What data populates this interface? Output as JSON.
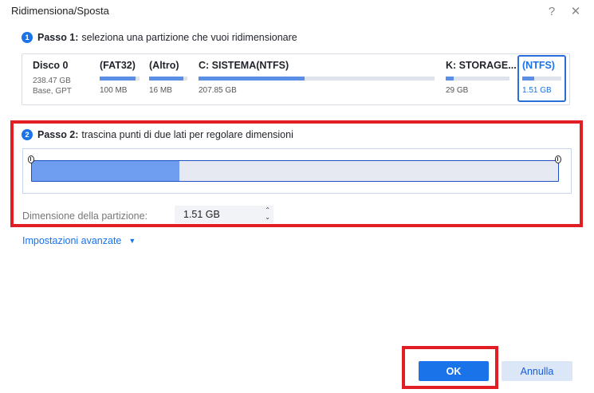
{
  "window": {
    "title": "Ridimensiona/Sposta",
    "help_glyph": "?",
    "close_glyph": "✕"
  },
  "step1": {
    "number": "1",
    "label": "Passo 1:",
    "text": "seleziona una partizione che vuoi ridimensionare"
  },
  "disk": {
    "name": "Disco 0",
    "capacity": "238.47 GB",
    "type": "Base, GPT"
  },
  "partitions": [
    {
      "name": "(FAT32)",
      "size": "100 MB",
      "used_fraction": 0.9
    },
    {
      "name": "(Altro)",
      "size": "16 MB",
      "used_fraction": 0.9
    },
    {
      "name": "C: SISTEMA(NTFS)",
      "size": "207.85 GB",
      "used_fraction": 0.45
    },
    {
      "name": "K: STORAGE...",
      "size": "29 GB",
      "used_fraction": 0.12
    },
    {
      "name": "(NTFS)",
      "size": "1.51 GB",
      "used_fraction": 0.3,
      "selected": true
    }
  ],
  "step2": {
    "number": "2",
    "label": "Passo 2:",
    "text": "trascina punti di due lati per regolare dimensioni"
  },
  "slider": {
    "used_fraction": 0.28
  },
  "size_field": {
    "label": "Dimensione della partizione:",
    "value": "1.51 GB",
    "up_glyph": "⌃",
    "down_glyph": "⌄"
  },
  "advanced": {
    "label": "Impostazioni avanzate",
    "caret": "▼"
  },
  "buttons": {
    "ok": "OK",
    "cancel": "Annulla"
  },
  "colors": {
    "accent": "#1a73e8",
    "highlight": "#e01e24",
    "bar_fill": "#5b8fe6",
    "slider_fill": "#6f9ef0"
  }
}
